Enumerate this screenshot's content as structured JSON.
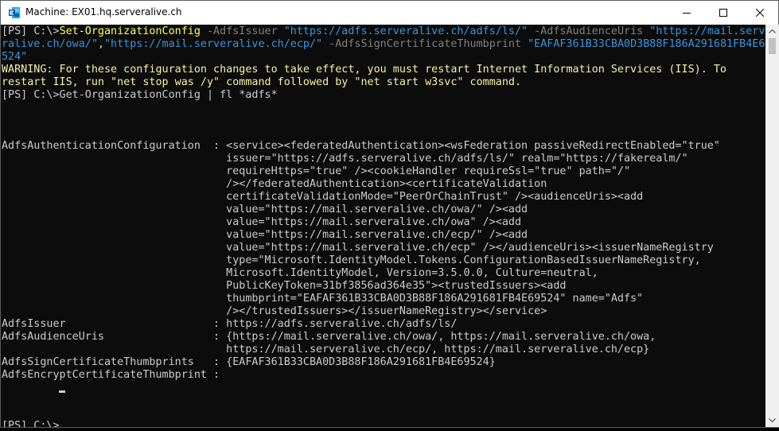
{
  "window": {
    "title": "Machine: EX01.hq.serveralive.ch",
    "icon": "exchange-management-shell-icon",
    "accent": "#0078d4"
  },
  "console": {
    "lines": [
      [
        {
          "t": "[PS] C:\\>",
          "c": "default"
        },
        {
          "t": "Set-OrganizationConfig",
          "c": "cmd"
        },
        {
          "t": " -AdfsIssuer ",
          "c": "param"
        },
        {
          "t": "\"https://adfs.serveralive.ch/adfs/ls/\"",
          "c": "str"
        },
        {
          "t": " -AdfsAudienceUris ",
          "c": "param"
        },
        {
          "t": "\"https://mail.serve",
          "c": "str"
        }
      ],
      [
        {
          "t": "ralive.ch/owa/\"",
          "c": "str"
        },
        {
          "t": ",",
          "c": "default"
        },
        {
          "t": "\"https://mail.serveralive.ch/ecp/\"",
          "c": "str"
        },
        {
          "t": " -AdfsSignCertificateThumbprint ",
          "c": "param"
        },
        {
          "t": "\"EAFAF361B33CBA0D3B88F186A291681FB4E69",
          "c": "str"
        }
      ],
      [
        {
          "t": "524\"",
          "c": "str"
        }
      ],
      [
        {
          "t": "WARNING: For these configuration changes to take effect, you must restart Internet Information Services (IIS). To",
          "c": "warn"
        }
      ],
      [
        {
          "t": "restart IIS, run \"net stop was /y\" command followed by \"net start w3svc\" command.",
          "c": "warn"
        }
      ],
      [
        {
          "t": "[PS] C:\\>Get-OrganizationConfig | fl *adfs*",
          "c": "default"
        }
      ],
      [],
      [],
      [],
      [
        {
          "t": "AdfsAuthenticationConfiguration  : <service><federatedAuthentication><wsFederation passiveRedirectEnabled=\"true\"",
          "c": "default"
        }
      ],
      [
        {
          "t": "                                   issuer=\"https://adfs.serveralive.ch/adfs/ls/\" realm=\"https://fakerealm/\"",
          "c": "default"
        }
      ],
      [
        {
          "t": "                                   requireHttps=\"true\" /><cookieHandler requireSsl=\"true\" path=\"/\"",
          "c": "default"
        }
      ],
      [
        {
          "t": "                                   /></federatedAuthentication><certificateValidation",
          "c": "default"
        }
      ],
      [
        {
          "t": "                                   certificateValidationMode=\"PeerOrChainTrust\" /><audienceUris><add",
          "c": "default"
        }
      ],
      [
        {
          "t": "                                   value=\"https://mail.serveralive.ch/owa/\" /><add",
          "c": "default"
        }
      ],
      [
        {
          "t": "                                   value=\"https://mail.serveralive.ch/owa\" /><add",
          "c": "default"
        }
      ],
      [
        {
          "t": "                                   value=\"https://mail.serveralive.ch/ecp/\" /><add",
          "c": "default"
        }
      ],
      [
        {
          "t": "                                   value=\"https://mail.serveralive.ch/ecp\" /></audienceUris><issuerNameRegistry",
          "c": "default"
        }
      ],
      [
        {
          "t": "                                   type=\"Microsoft.IdentityModel.Tokens.ConfigurationBasedIssuerNameRegistry,",
          "c": "default"
        }
      ],
      [
        {
          "t": "                                   Microsoft.IdentityModel, Version=3.5.0.0, Culture=neutral,",
          "c": "default"
        }
      ],
      [
        {
          "t": "                                   PublicKeyToken=31bf3856ad364e35\"><trustedIssuers><add",
          "c": "default"
        }
      ],
      [
        {
          "t": "                                   thumbprint=\"EAFAF361B33CBA0D3B88F186A291681FB4E69524\" name=\"Adfs\"",
          "c": "default"
        }
      ],
      [
        {
          "t": "                                   /></trustedIssuers></issuerNameRegistry></service>",
          "c": "default"
        }
      ],
      [
        {
          "t": "AdfsIssuer                       : https://adfs.serveralive.ch/adfs/ls/",
          "c": "default"
        }
      ],
      [
        {
          "t": "AdfsAudienceUris                 : {https://mail.serveralive.ch/owa/, https://mail.serveralive.ch/owa,",
          "c": "default"
        }
      ],
      [
        {
          "t": "                                   https://mail.serveralive.ch/ecp/, https://mail.serveralive.ch/ecp}",
          "c": "default"
        }
      ],
      [
        {
          "t": "AdfsSignCertificateThumbprints   : {EAFAF361B33CBA0D3B88F186A291681FB4E69524}",
          "c": "default"
        }
      ],
      [
        {
          "t": "AdfsEncryptCertificateThumbprint :",
          "c": "default"
        }
      ],
      [],
      [],
      [],
      [
        {
          "t": "[PS] C:\\>",
          "c": "default"
        }
      ]
    ]
  },
  "colors": {
    "background": "#0c0c0c",
    "default": "#cccccc",
    "cmd": "#ffff55",
    "param": "#808080",
    "str": "#3a96dd",
    "warn": "#f9f1a5"
  }
}
